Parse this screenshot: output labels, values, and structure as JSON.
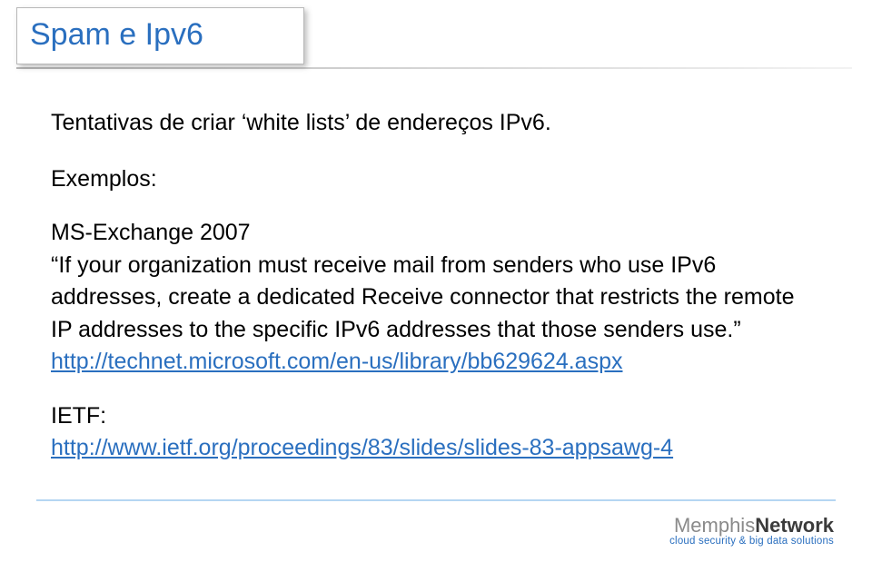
{
  "slide": {
    "title": "Spam e Ipv6",
    "subtitle_prefix": "Tentativas de criar ",
    "subtitle_quoted": "white lists",
    "subtitle_suffix": " de endereços IPv6.",
    "examples_label": "Exemplos:",
    "exchange_header": "MS-Exchange 2007",
    "exchange_quote": "If your organization must receive mail from senders who use IPv6 addresses, create a dedicated Receive connector that restricts the remote IP addresses to the specific IPv6 addresses that those senders use.",
    "exchange_link": "http://technet.microsoft.com/en-us/library/bb629624.aspx",
    "ietf_label": "IETF:",
    "ietf_link": "http://www.ietf.org/proceedings/83/slides/slides-83-appsawg-4"
  },
  "footer": {
    "logo_left": "Memphis",
    "logo_right": "Network",
    "tagline": "cloud security & big data solutions"
  }
}
